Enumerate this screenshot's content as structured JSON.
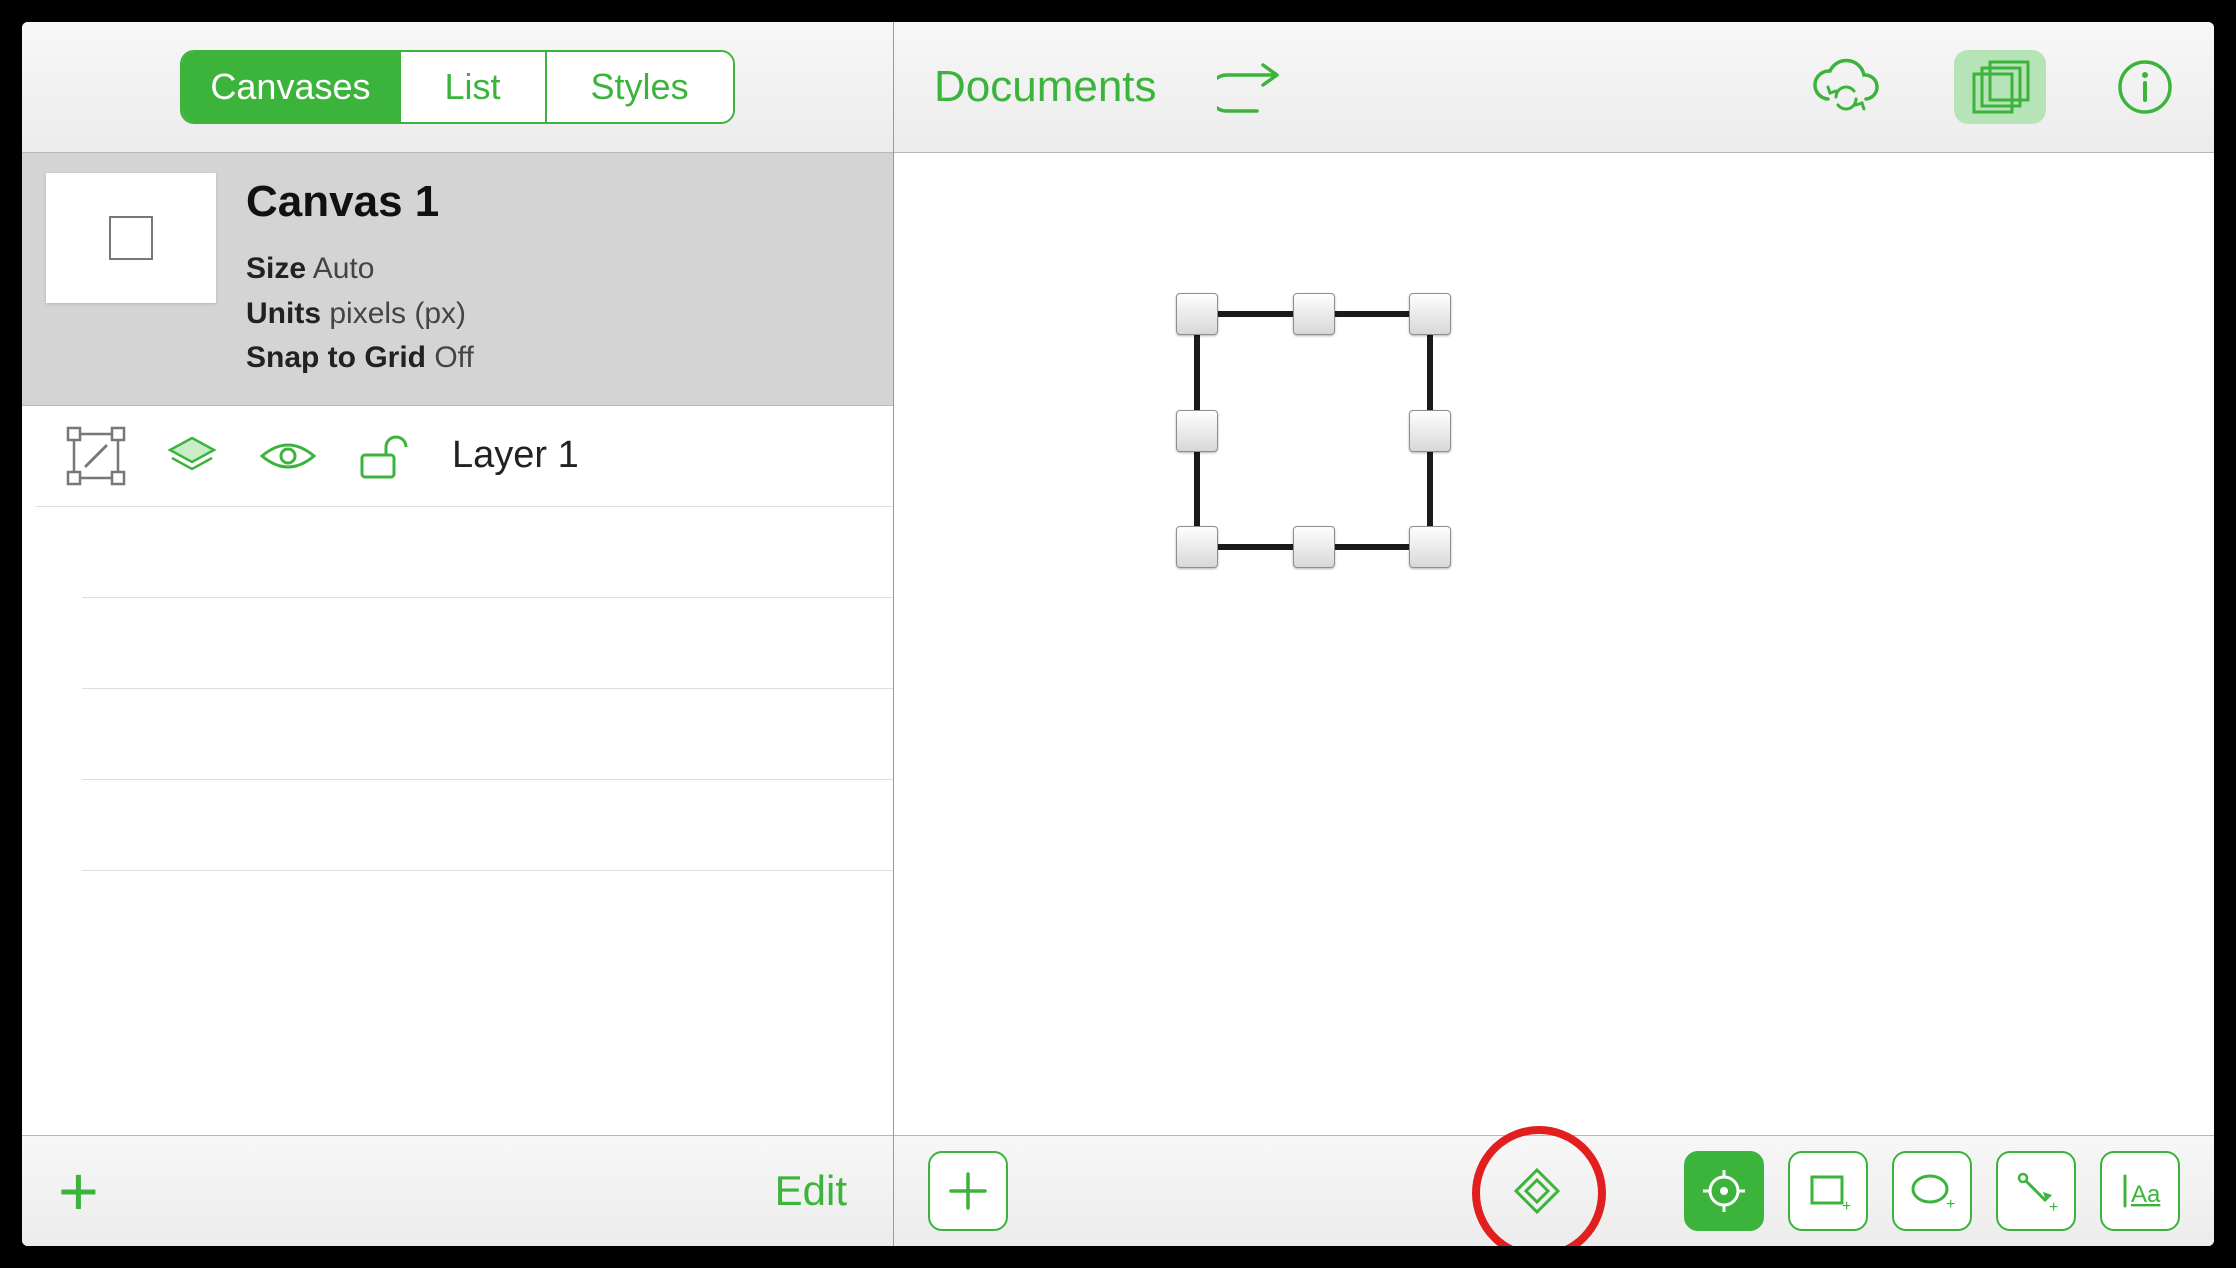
{
  "sidebar": {
    "tabs": {
      "canvases": "Canvases",
      "list": "List",
      "styles": "Styles",
      "active": "canvases"
    },
    "canvas": {
      "title": "Canvas 1",
      "size_label": "Size",
      "size_value": "Auto",
      "units_label": "Units",
      "units_value": "pixels (px)",
      "snap_label": "Snap to Grid",
      "snap_value": "Off"
    },
    "layer": {
      "name": "Layer 1"
    },
    "edit_label": "Edit"
  },
  "header": {
    "documents_label": "Documents"
  },
  "tools": {
    "add": "add",
    "diamond": "diamond",
    "target": "target",
    "rect": "rect",
    "ellipse": "ellipse",
    "line": "line",
    "text": "text"
  },
  "colors": {
    "accent": "#3cb43c",
    "annotation": "#e21f1f"
  }
}
